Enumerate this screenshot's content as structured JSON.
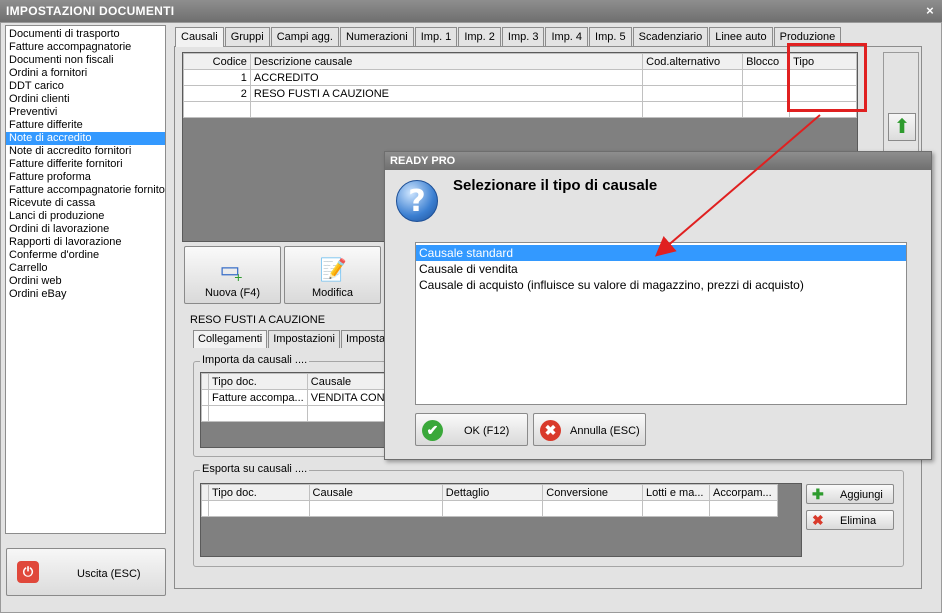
{
  "window": {
    "title": "IMPOSTAZIONI DOCUMENTI",
    "close_glyph": "×"
  },
  "doc_list": {
    "items": [
      "Documenti di trasporto",
      "Fatture accompagnatorie",
      "Documenti non fiscali",
      "Ordini a fornitori",
      "DDT carico",
      "Ordini clienti",
      "Preventivi",
      "Fatture differite",
      "Note di accredito",
      "Note di accredito fornitori",
      "Fatture differite fornitori",
      "Fatture proforma",
      "Fatture accompagnatorie fornito",
      "Ricevute di cassa",
      "Lanci di produzione",
      "Ordini di lavorazione",
      "Rapporti di lavorazione",
      "Conferme d'ordine",
      "Carrello",
      "Ordini web",
      "Ordini eBay"
    ],
    "selected": "Note di accredito"
  },
  "exit_button": {
    "label": "Uscita (ESC)",
    "icon": "power-icon"
  },
  "tabs": [
    "Causali",
    "Gruppi",
    "Campi agg.",
    "Numerazioni",
    "Imp. 1",
    "Imp. 2",
    "Imp. 3",
    "Imp. 4",
    "Imp. 5",
    "Scadenziario",
    "Linee auto",
    "Produzione"
  ],
  "causali_grid": {
    "columns": [
      "Codice",
      "Descrizione causale",
      "Cod.alternativo",
      "Blocco",
      "Tipo"
    ],
    "rows": [
      [
        "1",
        "ACCREDITO",
        "",
        "",
        ""
      ],
      [
        "2",
        "RESO FUSTI A CAUZIONE",
        "",
        "",
        ""
      ]
    ]
  },
  "buttons": {
    "new": "Nuova (F4)",
    "edit": "Modifica"
  },
  "selected_causale": "RESO FUSTI A CAUZIONE",
  "subtabs": [
    "Collegamenti",
    "Impostazioni",
    "Imposta"
  ],
  "import_group": {
    "title": "Importa da causali ....",
    "columns": [
      "Tipo doc.",
      "Causale"
    ],
    "rows": [
      [
        "Fatture accompa...",
        "VENDITA CON F"
      ]
    ]
  },
  "export_group": {
    "title": "Esporta su causali ....",
    "columns": [
      "Tipo doc.",
      "Causale",
      "Dettaglio",
      "Conversione",
      "Lotti e ma...",
      "Accorpam..."
    ],
    "add_label": "Aggiungi",
    "delete_label": "Elimina"
  },
  "dialog": {
    "title": "READY PRO",
    "prompt": "Selezionare il tipo di causale",
    "options": [
      "Causale standard",
      "Causale di vendita",
      "Causale di acquisto (influisce su valore di magazzino, prezzi di acquisto)"
    ],
    "selected": "Causale standard",
    "ok_label": "OK (F12)",
    "cancel_label": "Annulla (ESC)"
  },
  "colors": {
    "selection": "#3399ff",
    "annotation": "#e02020",
    "titlebar": "#7a7a7a"
  }
}
